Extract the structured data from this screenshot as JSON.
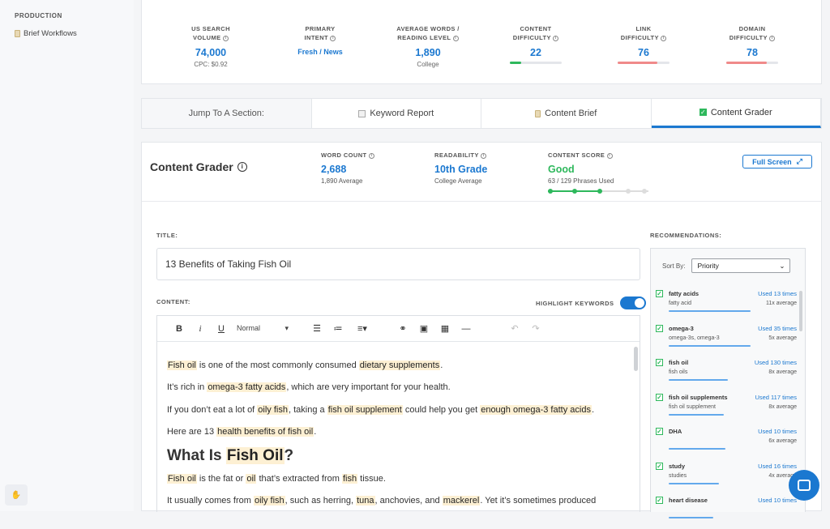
{
  "sidebar": {
    "section": "PRODUCTION",
    "item": "Brief Workflows"
  },
  "metrics": [
    {
      "label1": "US SEARCH",
      "label2": "VOLUME",
      "value": "74,000",
      "sub": "CPC: $0.92"
    },
    {
      "label1": "PRIMARY",
      "label2": "INTENT",
      "value": "Fresh / News"
    },
    {
      "label1": "AVERAGE WORDS /",
      "label2": "READING LEVEL",
      "value": "1,890",
      "sub": "College"
    },
    {
      "label1": "CONTENT",
      "label2": "DIFFICULTY",
      "value": "22",
      "bar_fraction": 0.22,
      "bar_color": "#2eb85c"
    },
    {
      "label1": "LINK",
      "label2": "DIFFICULTY",
      "value": "76",
      "bar_fraction": 0.76,
      "bar_color": "#f08a8a"
    },
    {
      "label1": "DOMAIN",
      "label2": "DIFFICULTY",
      "value": "78",
      "bar_fraction": 0.78,
      "bar_color": "#f08a8a"
    }
  ],
  "jump": {
    "label": "Jump To A Section:",
    "tabs": [
      "Keyword Report",
      "Content Brief",
      "Content Grader"
    ]
  },
  "grader": {
    "title": "Content Grader",
    "word_count": {
      "label": "WORD COUNT",
      "value": "2,688",
      "sub": "1,890 Average"
    },
    "readability": {
      "label": "READABILITY",
      "value": "10th Grade",
      "sub": "College Average"
    },
    "content_score": {
      "label": "CONTENT SCORE",
      "value": "Good",
      "sub": "63 / 129 Phrases Used"
    },
    "full_screen": "Full Screen",
    "title_label": "TITLE:",
    "title_value": "13 Benefits of Taking Fish Oil",
    "content_label": "CONTENT:",
    "highlight_label": "HIGHLIGHT KEYWORDS",
    "format_value": "Normal",
    "recommendations_label": "RECOMMENDATIONS:",
    "sort_label": "Sort By:",
    "sort_value": "Priority"
  },
  "colors": {
    "accent": "#1b78d0",
    "good": "#2eb85c",
    "highlight": "#fdf0d3"
  },
  "recommendations": [
    {
      "keyword": "fatty acids",
      "used": "Used 13 times",
      "variants": "fatty acid",
      "avg": "11x average",
      "fill": 0.92
    },
    {
      "keyword": "omega-3",
      "used": "Used 35 times",
      "variants": "omega-3s, omega-3",
      "avg": "5x average",
      "fill": 0.92
    },
    {
      "keyword": "fish oil",
      "used": "Used 130 times",
      "variants": "fish oils",
      "avg": "8x average",
      "fill": 0.66
    },
    {
      "keyword": "fish oil supplements",
      "used": "Used 117 times",
      "variants": "fish oil supplement",
      "avg": "8x average",
      "fill": 0.62
    },
    {
      "keyword": "DHA",
      "used": "Used 10 times",
      "variants": "",
      "avg": "6x average",
      "fill": 0.64
    },
    {
      "keyword": "study",
      "used": "Used 16 times",
      "variants": "studies",
      "avg": "4x average",
      "fill": 0.56
    },
    {
      "keyword": "heart disease",
      "used": "Used 10 times",
      "variants": "",
      "avg": "",
      "fill": 0.5
    }
  ]
}
